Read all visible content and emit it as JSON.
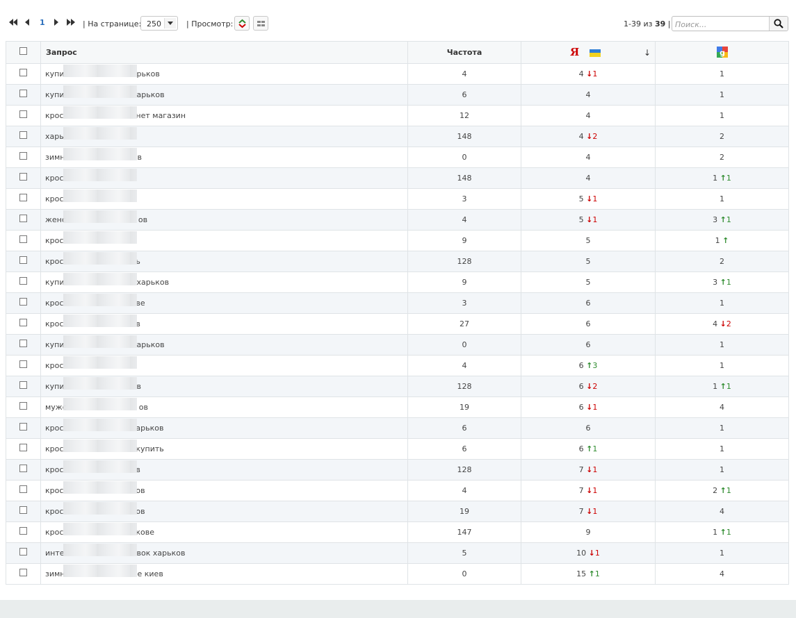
{
  "toolbar": {
    "page_number": "1",
    "per_page_label": "| На странице:",
    "per_page_value": "250",
    "view_label": "| Просмотр:",
    "count_range": "1-39 из",
    "count_total": "39",
    "count_sep": "|",
    "search_placeholder": "Поиск..."
  },
  "table": {
    "headers": {
      "query": "Запрос",
      "frequency": "Частота",
      "yandex_logo": "Я",
      "sort_arrow": "↓"
    },
    "rows": [
      {
        "prefix": "купи",
        "suffix": "рьков",
        "freq": "4",
        "y": "4",
        "y_dir": "down",
        "y_delta": "1",
        "g": "1",
        "g_dir": "",
        "g_delta": ""
      },
      {
        "prefix": "купи",
        "suffix": "арьков",
        "freq": "6",
        "y": "4",
        "y_dir": "",
        "y_delta": "",
        "g": "1",
        "g_dir": "",
        "g_delta": ""
      },
      {
        "prefix": "крос",
        "suffix": "нет магазин",
        "freq": "12",
        "y": "4",
        "y_dir": "",
        "y_delta": "",
        "g": "1",
        "g_dir": "",
        "g_delta": ""
      },
      {
        "prefix": "харь",
        "suffix": "",
        "freq": "148",
        "y": "4",
        "y_dir": "down",
        "y_delta": "2",
        "g": "2",
        "g_dir": "",
        "g_delta": ""
      },
      {
        "prefix": "зимн",
        "suffix": "в",
        "freq": "0",
        "y": "4",
        "y_dir": "",
        "y_delta": "",
        "g": "2",
        "g_dir": "",
        "g_delta": ""
      },
      {
        "prefix": "крос",
        "suffix": "",
        "freq": "148",
        "y": "4",
        "y_dir": "",
        "y_delta": "",
        "g": "1",
        "g_dir": "up",
        "g_delta": "1"
      },
      {
        "prefix": "крос",
        "suffix": "",
        "freq": "3",
        "y": "5",
        "y_dir": "down",
        "y_delta": "1",
        "g": "1",
        "g_dir": "",
        "g_delta": ""
      },
      {
        "prefix": "женс",
        "suffix": "ов",
        "freq": "4",
        "y": "5",
        "y_dir": "down",
        "y_delta": "1",
        "g": "3",
        "g_dir": "up",
        "g_delta": "1"
      },
      {
        "prefix": "крос",
        "suffix": "",
        "freq": "9",
        "y": "5",
        "y_dir": "",
        "y_delta": "",
        "g": "1",
        "g_dir": "up",
        "g_delta": ""
      },
      {
        "prefix": "крос",
        "suffix": "ь",
        "freq": "128",
        "y": "5",
        "y_dir": "",
        "y_delta": "",
        "g": "2",
        "g_dir": "",
        "g_delta": ""
      },
      {
        "prefix": "купи",
        "suffix": "харьков",
        "freq": "9",
        "y": "5",
        "y_dir": "",
        "y_delta": "",
        "g": "3",
        "g_dir": "up",
        "g_delta": "1"
      },
      {
        "prefix": "крос",
        "suffix": "ве",
        "freq": "3",
        "y": "6",
        "y_dir": "",
        "y_delta": "",
        "g": "1",
        "g_dir": "",
        "g_delta": ""
      },
      {
        "prefix": "крос",
        "suffix": "в",
        "freq": "27",
        "y": "6",
        "y_dir": "",
        "y_delta": "",
        "g": "4",
        "g_dir": "down",
        "g_delta": "2"
      },
      {
        "prefix": "купи",
        "suffix": "арьков",
        "freq": "0",
        "y": "6",
        "y_dir": "",
        "y_delta": "",
        "g": "1",
        "g_dir": "",
        "g_delta": ""
      },
      {
        "prefix": "крос",
        "suffix": "",
        "freq": "4",
        "y": "6",
        "y_dir": "up",
        "y_delta": "3",
        "g": "1",
        "g_dir": "",
        "g_delta": ""
      },
      {
        "prefix": "купи",
        "suffix": "в",
        "freq": "128",
        "y": "6",
        "y_dir": "down",
        "y_delta": "2",
        "g": "1",
        "g_dir": "up",
        "g_delta": "1"
      },
      {
        "prefix": "мужс",
        "suffix": "ов",
        "freq": "19",
        "y": "6",
        "y_dir": "down",
        "y_delta": "1",
        "g": "4",
        "g_dir": "",
        "g_delta": ""
      },
      {
        "prefix": "крос",
        "suffix": "арьков",
        "freq": "6",
        "y": "6",
        "y_dir": "",
        "y_delta": "",
        "g": "1",
        "g_dir": "",
        "g_delta": ""
      },
      {
        "prefix": "крос",
        "suffix": "купить",
        "freq": "6",
        "y": "6",
        "y_dir": "up",
        "y_delta": "1",
        "g": "1",
        "g_dir": "",
        "g_delta": ""
      },
      {
        "prefix": "крос",
        "suffix": "в",
        "freq": "128",
        "y": "7",
        "y_dir": "down",
        "y_delta": "1",
        "g": "1",
        "g_dir": "",
        "g_delta": ""
      },
      {
        "prefix": "крос",
        "suffix": "ов",
        "freq": "4",
        "y": "7",
        "y_dir": "down",
        "y_delta": "1",
        "g": "2",
        "g_dir": "up",
        "g_delta": "1"
      },
      {
        "prefix": "крос",
        "suffix": "ов",
        "freq": "19",
        "y": "7",
        "y_dir": "down",
        "y_delta": "1",
        "g": "4",
        "g_dir": "",
        "g_delta": ""
      },
      {
        "prefix": "крос",
        "suffix": "кове",
        "freq": "147",
        "y": "9",
        "y_dir": "",
        "y_delta": "",
        "g": "1",
        "g_dir": "up",
        "g_delta": "1"
      },
      {
        "prefix": "инте",
        "suffix": "вок харьков",
        "freq": "5",
        "y": "10",
        "y_dir": "down",
        "y_delta": "1",
        "g": "1",
        "g_dir": "",
        "g_delta": ""
      },
      {
        "prefix": "зимн",
        "suffix": "е киев",
        "freq": "0",
        "y": "15",
        "y_dir": "up",
        "y_delta": "1",
        "g": "4",
        "g_dir": "",
        "g_delta": ""
      }
    ]
  },
  "colors": {
    "down": "#cc0000",
    "up": "#2e8b2e",
    "row_alt": "#f3f6f9",
    "header_bg": "#f6f8f9"
  },
  "icons": [
    "first-page-icon",
    "prev-page-icon",
    "next-page-icon",
    "last-page-icon",
    "dropdown-arrow-icon",
    "sort-view-icon",
    "grid-view-icon",
    "search-icon",
    "yandex-icon",
    "ukraine-flag-icon",
    "google-icon",
    "arrow-down-icon",
    "arrow-up-icon"
  ]
}
